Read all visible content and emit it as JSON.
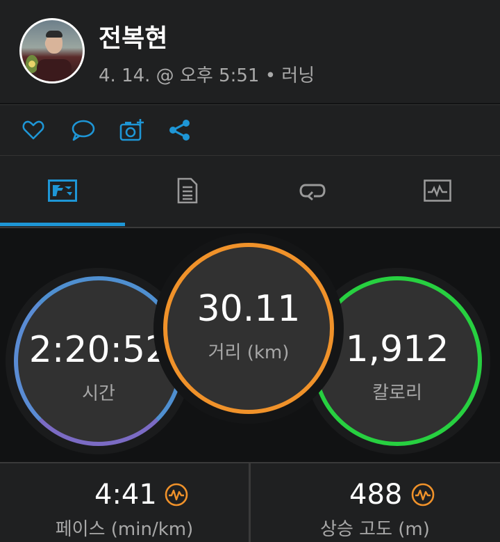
{
  "activity": {
    "user_name": "전복현",
    "meta": "4. 14. @ 오후 5:51 • 러닝"
  },
  "actions": [
    {
      "icon": "heart-icon"
    },
    {
      "icon": "comment-icon"
    },
    {
      "icon": "camera-add-icon"
    },
    {
      "icon": "share-icon"
    }
  ],
  "tabs": [
    {
      "icon": "overview-icon",
      "active": true
    },
    {
      "icon": "details-icon",
      "active": false
    },
    {
      "icon": "laps-icon",
      "active": false
    },
    {
      "icon": "chart-icon",
      "active": false
    }
  ],
  "summary": {
    "time": {
      "value": "2:20:52",
      "label": "시간"
    },
    "distance": {
      "value": "30.11",
      "label": "거리 (km)"
    },
    "calories": {
      "value": "1,912",
      "label": "칼로리"
    }
  },
  "stats": {
    "pace": {
      "value": "4:41",
      "label": "페이스 (min/km)"
    },
    "elevation_gain": {
      "value": "488",
      "label": "상승 고도 (m)"
    }
  },
  "colors": {
    "accent": "#1e96d6",
    "time_ring": "#4f8fd0",
    "distance_ring": "#f0922a",
    "calories_ring": "#27d040",
    "stat_icon": "#f0922a"
  }
}
